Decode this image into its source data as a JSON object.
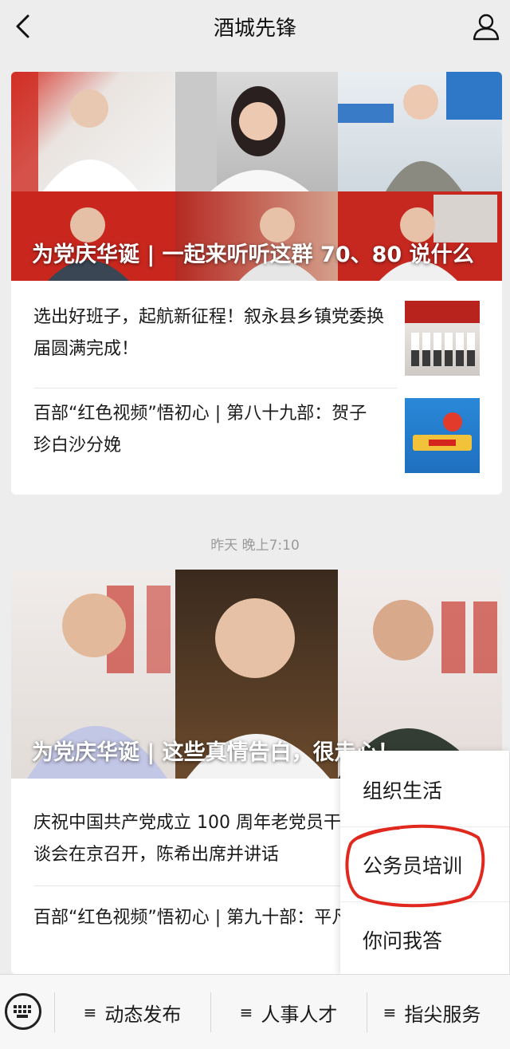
{
  "header": {
    "title": "酒城先锋"
  },
  "articles": [
    {
      "cover_title": "为党庆华诞 | 一起来听听这群 70、80 说什么",
      "items": [
        {
          "text": "选出好班子，起航新征程！叙永县乡镇党委换届圆满完成！"
        },
        {
          "text": "百部“红色视频”悟初心 | 第八十九部：贺子珍白沙分娩"
        }
      ]
    },
    {
      "timestamp": "昨天 晚上7:10",
      "cover_title": "为党庆华诞 | 这些真情告白，很走心！",
      "items": [
        {
          "text": "庆祝中国共产党成立 100 周年老党员干部座谈会在京召开，陈希出席并讲话"
        },
        {
          "text": "百部“红色视频”悟初心 | 第九十部：平凡"
        }
      ]
    }
  ],
  "popup_menu": {
    "items": [
      "组织生活",
      "公务员培训",
      "你问我答"
    ],
    "highlight_color": "#e0281e"
  },
  "bottom_menu": {
    "items": [
      "动态发布",
      "人事人才",
      "指尖服务"
    ]
  },
  "colors": {
    "background": "#ededed",
    "accent_red": "#d7241c"
  }
}
